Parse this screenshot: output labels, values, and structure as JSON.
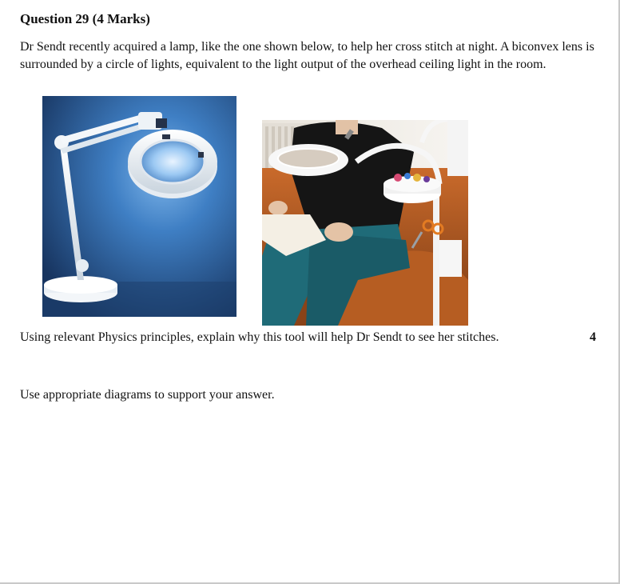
{
  "question": {
    "title": "Question 29 (4 Marks)",
    "body": "Dr Sendt recently acquired a lamp, like the one shown below, to help her cross stitch at night. A biconvex lens is surrounded by a circle of lights, equivalent to the light output of the overhead ceiling light in the room.",
    "prompt": "Using relevant Physics principles, explain why this tool will help Dr Sendt to see her stitches.",
    "marks": "4",
    "instruction": "Use appropriate diagrams to support your answer."
  }
}
